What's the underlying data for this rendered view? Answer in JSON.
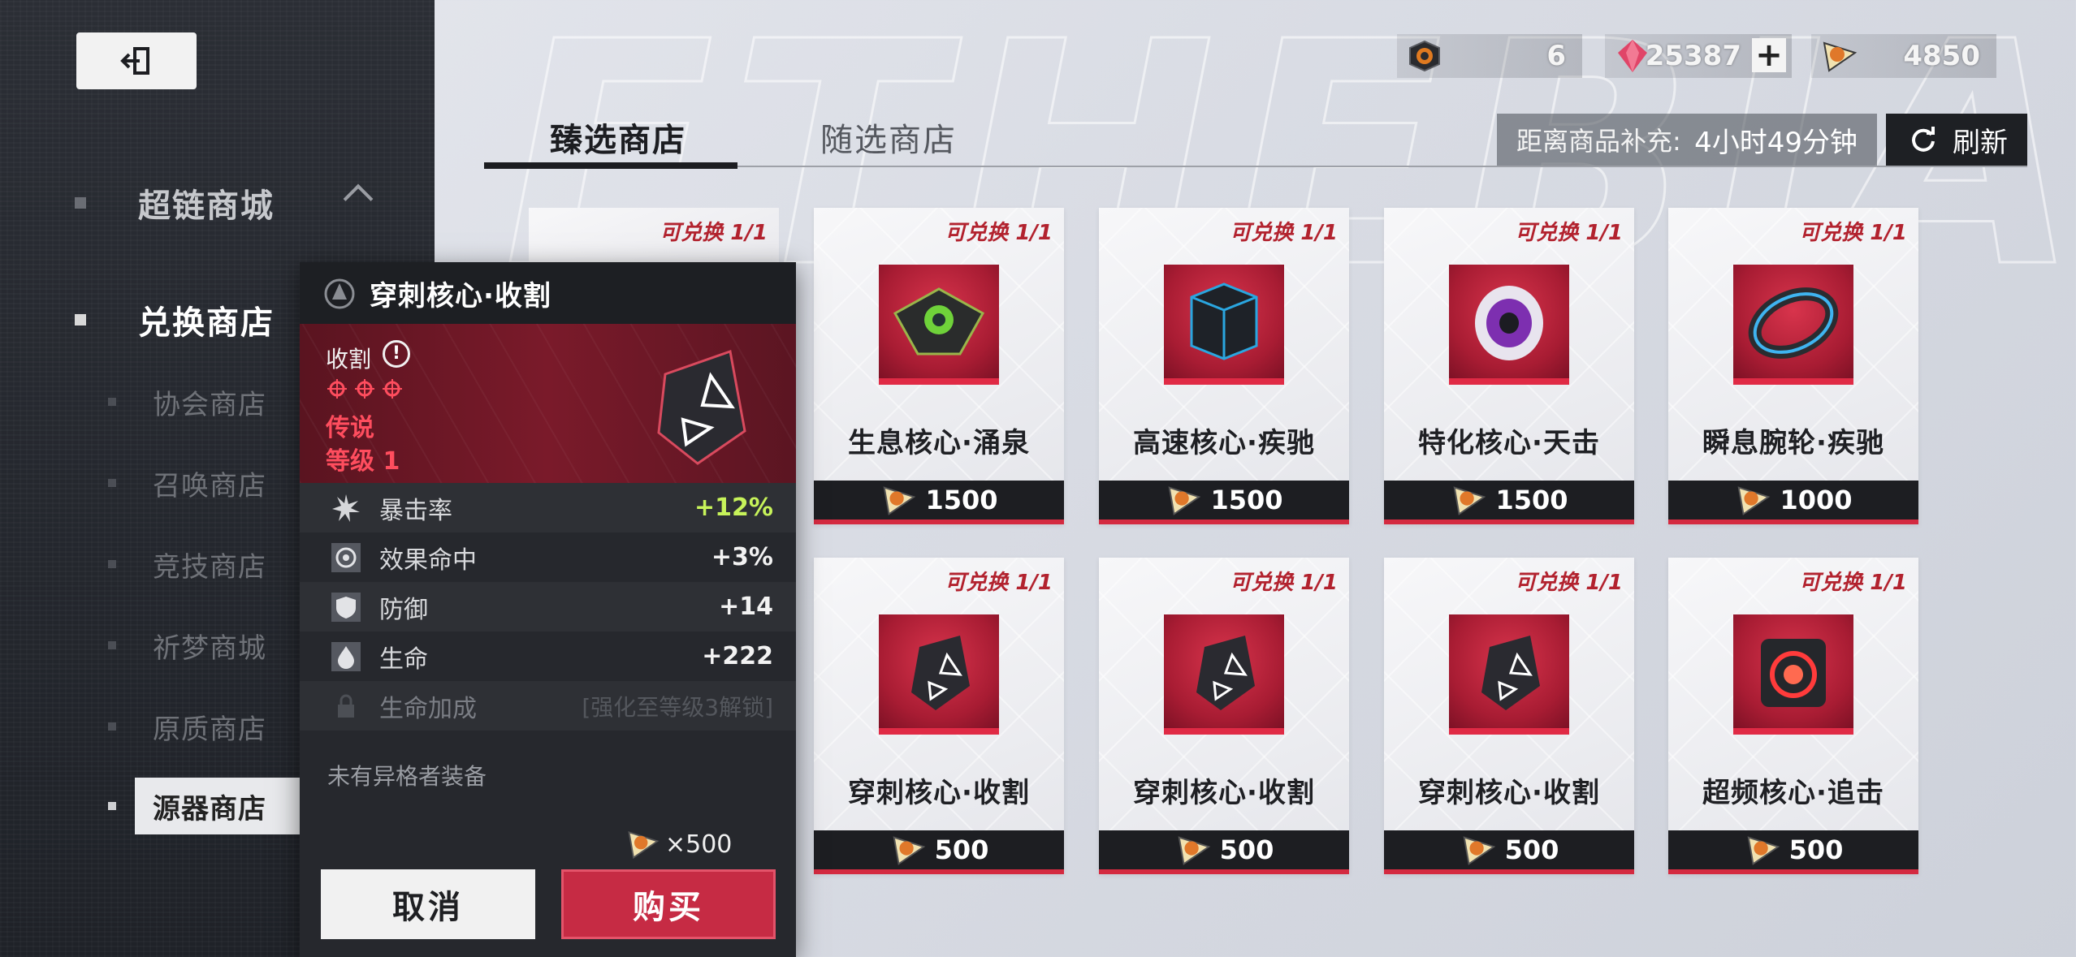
{
  "sidebar": {
    "exit_icon": "exit-icon",
    "groups": [
      {
        "label": "超链商城"
      },
      {
        "label": "兑换商店"
      }
    ],
    "items": [
      {
        "label": "协会商店"
      },
      {
        "label": "召唤商店"
      },
      {
        "label": "竞技商店"
      },
      {
        "label": "祈梦商城"
      },
      {
        "label": "原质商店"
      },
      {
        "label": "源器商店"
      }
    ]
  },
  "currency": [
    {
      "icon": "ticket-token-icon",
      "value": "6"
    },
    {
      "icon": "crystal-icon",
      "value": "25387"
    },
    {
      "icon": "coin-icon",
      "value": "4850"
    }
  ],
  "plus_label": "+",
  "tabs": [
    {
      "label": "臻选商店"
    },
    {
      "label": "随选商店"
    }
  ],
  "restock": {
    "label": "距离商品补充:",
    "time": "4小时49分钟"
  },
  "refresh_label": "刷新",
  "cards": [
    {
      "stock": "可兑换 1/1",
      "name": "生息核心·涌泉",
      "price": "1500"
    },
    {
      "stock": "可兑换 1/1",
      "name": "高速核心·疾驰",
      "price": "1500"
    },
    {
      "stock": "可兑换 1/1",
      "name": "特化核心·天击",
      "price": "1500"
    },
    {
      "stock": "可兑换 1/1",
      "name": "瞬息腕轮·疾驰",
      "price": "1000"
    },
    {
      "stock": "可兑换 1/1",
      "name": "穿刺核心·收割",
      "price": "500"
    },
    {
      "stock": "可兑换 1/1",
      "name": "穿刺核心·收割",
      "price": "500"
    },
    {
      "stock": "可兑换 1/1",
      "name": "穿刺核心·收割",
      "price": "500"
    },
    {
      "stock": "可兑换 1/1",
      "name": "超频核心·追击",
      "price": "500"
    }
  ],
  "ghost_card": {
    "stock": "可兑换 1/1"
  },
  "popup": {
    "title": "穿刺核心·收割",
    "set_name": "收割",
    "rarity": "传说",
    "level": "等级 1",
    "stats": [
      {
        "name": "暴击率",
        "value": "+12%"
      },
      {
        "name": "效果命中",
        "value": "+3%"
      },
      {
        "name": "防御",
        "value": "+14"
      },
      {
        "name": "生命",
        "value": "+222"
      },
      {
        "name": "生命加成",
        "value": "[强化至等级3解锁]"
      }
    ],
    "no_equip": "未有异格者装备",
    "cost": "×500",
    "cancel_label": "取消",
    "buy_label": "购买"
  },
  "colors": {
    "accent_red": "#c62b44",
    "stock_red": "#b2222e",
    "highlight_green": "#c7f35a"
  }
}
